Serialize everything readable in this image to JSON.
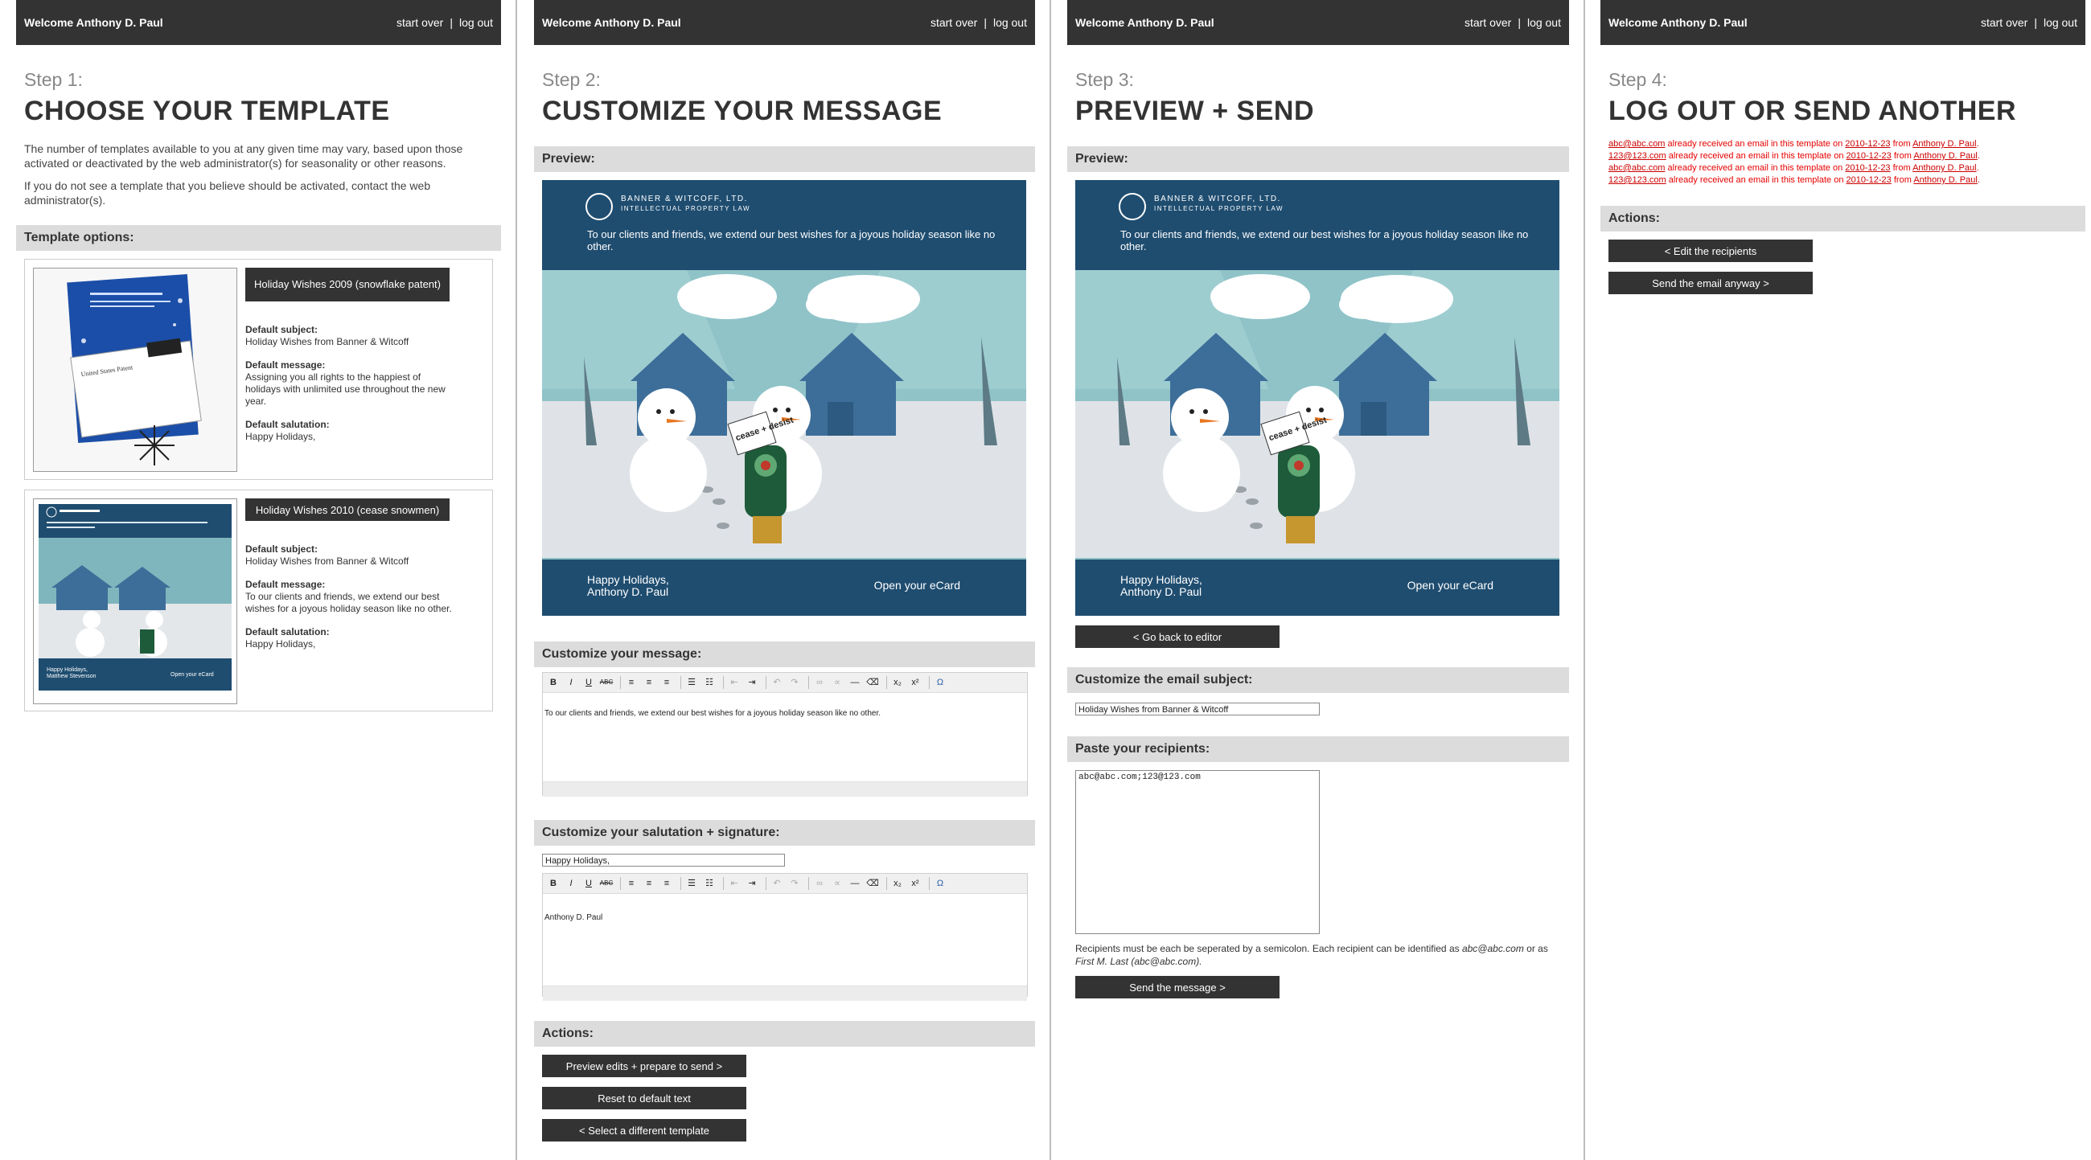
{
  "topbar": {
    "welcome": "Welcome Anthony D. Paul",
    "start_over": "start over",
    "separator": "|",
    "log_out": "log out"
  },
  "step1": {
    "step_label": "Step 1:",
    "title": "CHOOSE YOUR TEMPLATE",
    "intro_1": "The number of templates available to you at any given time may vary, based upon those activated or deactivated by the web administrator(s) for seasonality or other reasons.",
    "intro_2": "If you do not see a template that you believe should be activated, contact the web administrator(s).",
    "section_label": "Template options:",
    "templates": [
      {
        "button": "Holiday Wishes 2009 (snowflake patent)",
        "subject_label": "Default subject:",
        "subject": "Holiday Wishes from Banner & Witcoff",
        "message_label": "Default message:",
        "message": "Assigning you all rights to the happiest of holidays with unlimited use throughout the new year.",
        "salutation_label": "Default salutation:",
        "salutation": "Happy Holidays,"
      },
      {
        "button": "Holiday Wishes 2010 (cease snowmen)",
        "subject_label": "Default subject:",
        "subject": "Holiday Wishes from Banner & Witcoff",
        "message_label": "Default message:",
        "message": "To our clients and friends, we extend our best wishes for a joyous holiday season like no other.",
        "salutation_label": "Default salutation:",
        "salutation": "Happy Holidays,"
      }
    ]
  },
  "card": {
    "logo_line1": "BANNER & WITCOFF, LTD.",
    "logo_line2": "INTELLECTUAL PROPERTY LAW",
    "message": "To our clients and friends, we extend our best wishes for a joyous holiday season like no other.",
    "greeting_line1": "Happy Holidays,",
    "greeting_line2": "Anthony D. Paul",
    "open_label": "Open your eCard",
    "sign_text": "cease + desist",
    "thumb_greeting_line2": "Matthew Stevenson",
    "thumb_snowflake_text": "Assigning you all rights to the happiest of holidays with unlimited use throughout the new year.",
    "thumb_envelope": "United States Patent"
  },
  "step2": {
    "step_label": "Step 2:",
    "title": "CUSTOMIZE YOUR MESSAGE",
    "preview_label": "Preview:",
    "message_section": "Customize your message:",
    "message_text": "To our clients and friends, we extend our best wishes for a joyous holiday season like no other.",
    "salutation_section": "Customize your salutation + signature:",
    "salutation_value": "Happy Holidays,",
    "signature_text": "Anthony D. Paul",
    "actions_label": "Actions:",
    "btn_preview": "Preview edits + prepare to send >",
    "btn_reset": "Reset to default text",
    "btn_select": "< Select a different template"
  },
  "toolbar": {
    "bold": "B",
    "italic": "I",
    "underline": "U",
    "strike": "ABC",
    "undo": "↶",
    "redo": "↷",
    "hr": "—",
    "sub": "x₂",
    "sup": "x²",
    "omega": "Ω"
  },
  "step3": {
    "step_label": "Step 3:",
    "title": "PREVIEW + SEND",
    "preview_label": "Preview:",
    "btn_back": "< Go back to editor",
    "subject_section": "Customize the email subject:",
    "subject_value": "Holiday Wishes from Banner & Witcoff",
    "recipients_section": "Paste your recipients:",
    "recipients_value": "abc@abc.com;123@123.com",
    "help_text_1": "Recipients must be each be seperated by a semicolon. Each recipient can be identified as ",
    "help_text_em1": "abc@abc.com",
    "help_text_2": " or as ",
    "help_text_em2": "First M. Last (abc@abc.com).",
    "btn_send": "Send the message >"
  },
  "step4": {
    "step_label": "Step 4:",
    "title": "LOG OUT OR SEND ANOTHER",
    "errors": [
      {
        "email": "abc@abc.com",
        "mid": " already received an email in this template on ",
        "date": "2010-12-23",
        "from": " from ",
        "sender": "Anthony D. Paul",
        "end": "."
      },
      {
        "email": "123@123.com",
        "mid": " already received an email in this template on ",
        "date": "2010-12-23",
        "from": " from ",
        "sender": "Anthony D. Paul",
        "end": "."
      },
      {
        "email": "abc@abc.com",
        "mid": " already received an email in this template on ",
        "date": "2010-12-23",
        "from": " from ",
        "sender": "Anthony D. Paul",
        "end": "."
      },
      {
        "email": "123@123.com",
        "mid": " already received an email in this template on ",
        "date": "2010-12-23",
        "from": " from ",
        "sender": "Anthony D. Paul",
        "end": "."
      }
    ],
    "actions_label": "Actions:",
    "btn_edit": "< Edit the recipients",
    "btn_send_anyway": "Send the email anyway >"
  },
  "colors": {
    "topbar": "#333333",
    "section": "#dcdcdc",
    "card_blue": "#1f4d70",
    "sky": "#8fc3c8",
    "error": "#e60000"
  }
}
